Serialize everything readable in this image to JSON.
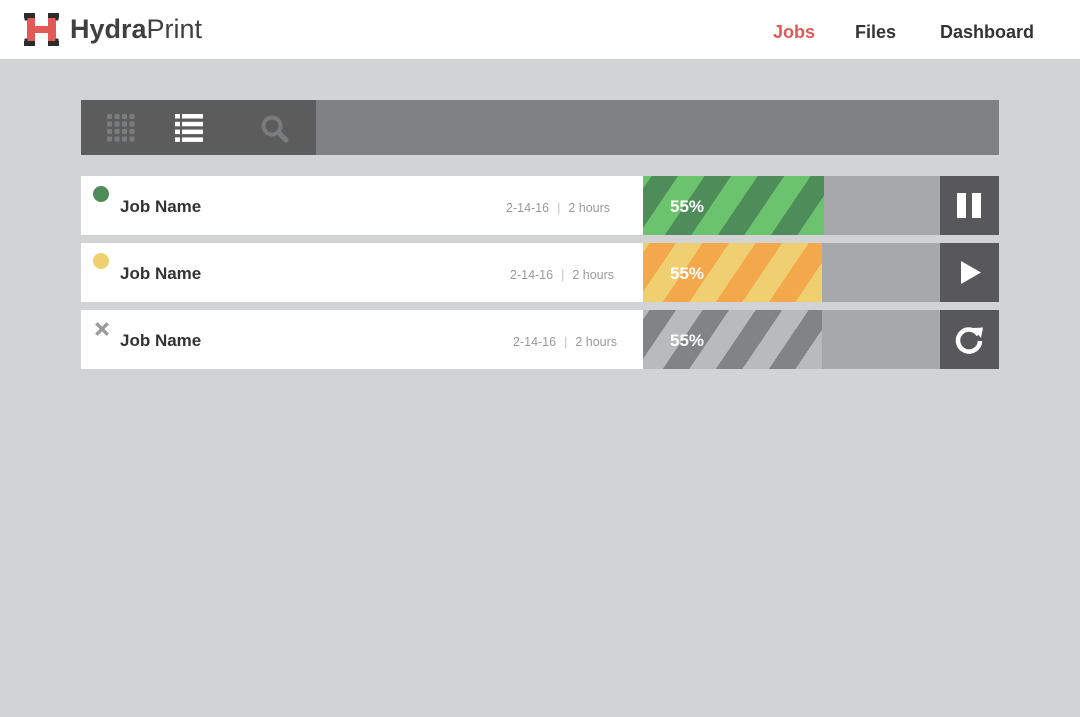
{
  "brand": {
    "name_bold": "Hydra",
    "name_regular": "Print",
    "logo_icon": "hydraprint-h-logo-icon",
    "logo_color": "#e15a55"
  },
  "nav": {
    "items": [
      {
        "label": "Jobs",
        "active": true
      },
      {
        "label": "Files",
        "active": false
      },
      {
        "label": "Dashboard",
        "active": false
      }
    ],
    "active_color": "#e15a55"
  },
  "toolbar": {
    "buttons": [
      {
        "icon": "grid-view-icon",
        "active": false
      },
      {
        "icon": "list-view-icon",
        "active": true
      },
      {
        "icon": "search-icon",
        "active": false
      }
    ]
  },
  "jobs": [
    {
      "name": "Job Name",
      "date": "2-14-16",
      "duration": "2 hours",
      "progress_label": "55%",
      "progress": 0.61,
      "status": "running",
      "status_icon": "green-status-dot",
      "status_color": "#4e8c5a",
      "stripe_colors": [
        "#6cc36e",
        "#4e8c5a"
      ],
      "action_icon": "pause-icon"
    },
    {
      "name": "Job Name",
      "date": "2-14-16",
      "duration": "2 hours",
      "progress_label": "55%",
      "progress": 0.61,
      "status": "paused",
      "status_icon": "yellow-status-dot",
      "status_color": "#f0cf70",
      "stripe_colors": [
        "#f0cf70",
        "#f3a94b"
      ],
      "action_icon": "play-icon"
    },
    {
      "name": "Job Name",
      "date": "2-14-16",
      "duration": "2 hours",
      "progress_label": "55%",
      "progress": 0.61,
      "status": "cancelled",
      "status_icon": "x-close-icon",
      "status_color": "#9a9a9a",
      "stripe_colors": [
        "#b9babc",
        "#828385"
      ],
      "action_icon": "refresh-icon"
    }
  ]
}
